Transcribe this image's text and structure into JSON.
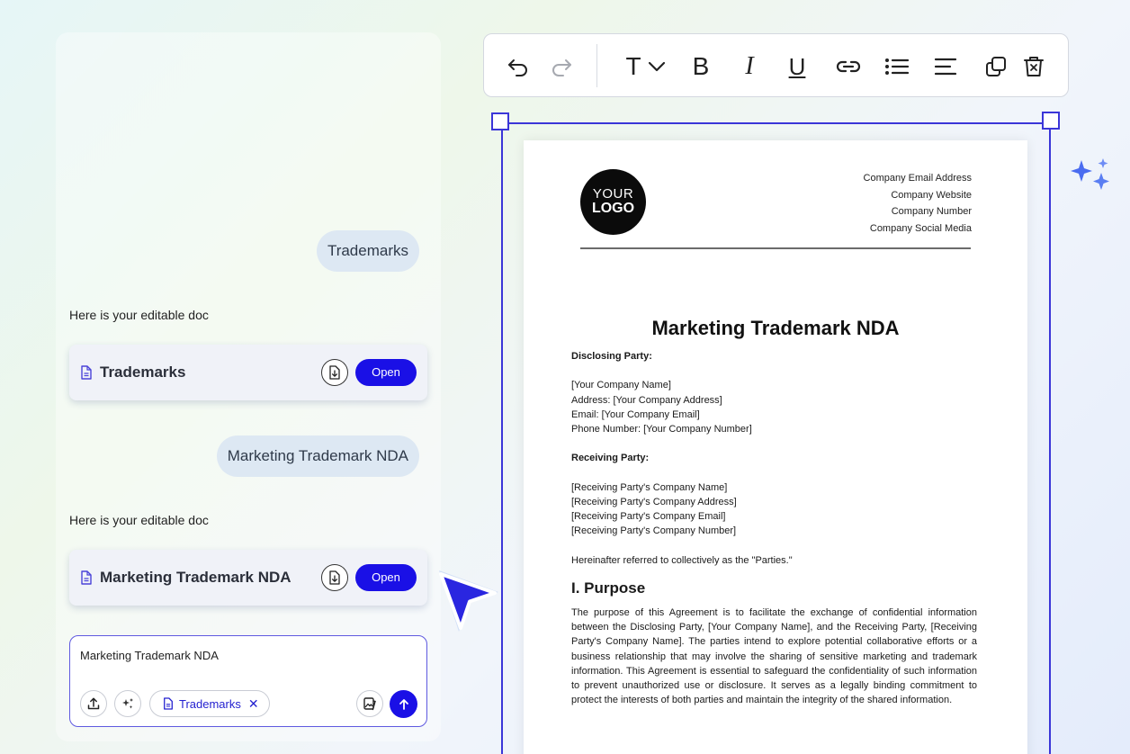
{
  "chat": {
    "messages": [
      {
        "role": "user",
        "text": "Trademarks"
      },
      {
        "role": "assistant",
        "text": "Here is your editable doc"
      },
      {
        "role": "user",
        "text": "Marketing Trademark NDA"
      },
      {
        "role": "assistant",
        "text": "Here is your editable doc"
      }
    ],
    "cards": [
      {
        "title": "Trademarks",
        "open_label": "Open"
      },
      {
        "title": "Marketing Trademark NDA",
        "open_label": "Open"
      }
    ],
    "composer": {
      "value": "Marketing Trademark NDA",
      "chip_label": "Trademarks",
      "chip_remove": "✕"
    }
  },
  "toolbar": {
    "text_style_glyph": "T",
    "bold_glyph": "B",
    "italic_glyph": "I",
    "underline_glyph": "U"
  },
  "document": {
    "logo_line1": "YOUR",
    "logo_line2": "LOGO",
    "company_info": [
      "Company Email Address",
      "Company Website",
      "Company Number",
      "Company Social Media"
    ],
    "title": "Marketing Trademark NDA",
    "disclosing_label": "Disclosing Party:",
    "disclosing_lines": [
      "[Your Company Name]",
      "Address: [Your Company Address]",
      "Email: [Your Company Email]",
      "Phone Number: [Your Company Number]"
    ],
    "receiving_label": "Receiving Party:",
    "receiving_lines": [
      "[Receiving Party's Company Name]",
      "[Receiving Party's Company Address]",
      "[Receiving Party's Company Email]",
      "[Receiving Party's Company Number]"
    ],
    "parties_note": "Hereinafter referred to collectively as the \"Parties.\"",
    "section1_heading": "I. Purpose",
    "section1_text": "The purpose of this Agreement is to facilitate the exchange of confidential information between the Disclosing Party, [Your Company Name], and the Receiving Party, [Receiving Party's Company Name]. The parties intend to explore potential collaborative efforts or a business relationship that may involve the sharing of sensitive marketing and trademark information. This Agreement is essential to safeguard the confidentiality of such information to prevent unauthorized use or disclosure. It serves as a legally binding commitment to protect the interests of both parties and maintain the integrity of the shared information."
  },
  "colors": {
    "accent": "#1a10e6",
    "selection": "#3b36d8",
    "user_bubble": "#dde8f3",
    "card_bg": "#f0f2f8"
  }
}
